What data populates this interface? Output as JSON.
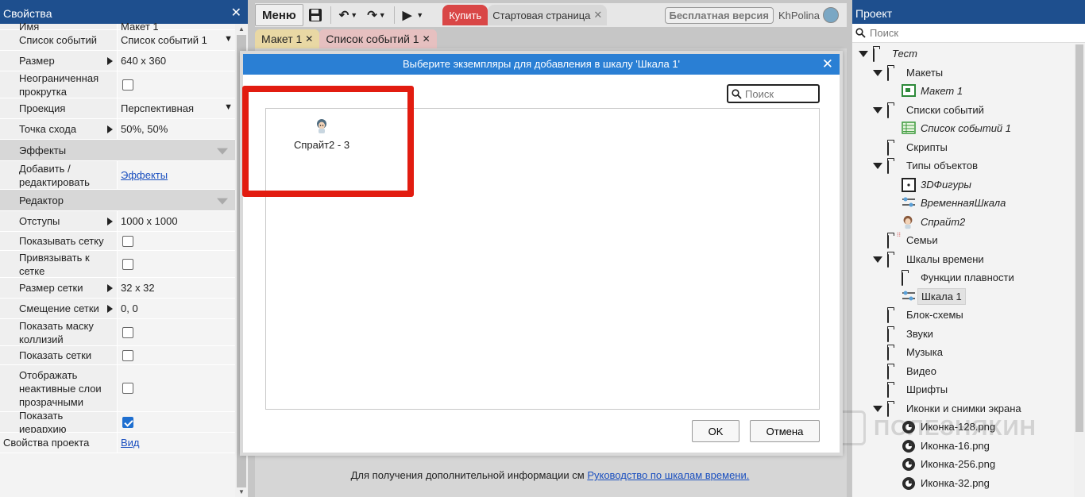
{
  "left_panel": {
    "title": "Свойства",
    "rows": [
      {
        "type": "value",
        "key": "Имя",
        "value": "Макет 1"
      },
      {
        "type": "select",
        "key": "Список событий",
        "value": "Список событий 1"
      },
      {
        "type": "expand",
        "key": "Размер",
        "value": "640 x 360"
      },
      {
        "type": "checkbox",
        "key": "Неограниченная прокрутка",
        "checked": false
      },
      {
        "type": "select",
        "key": "Проекция",
        "value": "Перспективная"
      },
      {
        "type": "expand",
        "key": "Точка схода",
        "value": "50%,  50%"
      },
      {
        "type": "section",
        "key": "Эффекты"
      },
      {
        "type": "link",
        "key": "Добавить / редактировать",
        "value": "Эффекты"
      },
      {
        "type": "section",
        "key": "Редактор"
      },
      {
        "type": "expand",
        "key": "Отступы",
        "value": "1000 x 1000"
      },
      {
        "type": "checkbox",
        "key": "Показывать сетку",
        "checked": false
      },
      {
        "type": "checkbox",
        "key": "Привязывать к сетке",
        "checked": false
      },
      {
        "type": "expand",
        "key": "Размер сетки",
        "value": "32 x 32"
      },
      {
        "type": "expand",
        "key": "Смещение сетки",
        "value": "0,  0"
      },
      {
        "type": "checkbox",
        "key": "Показать маску коллизий",
        "checked": false
      },
      {
        "type": "checkbox",
        "key": "Показать сетки",
        "checked": false
      },
      {
        "type": "checkbox",
        "key": "Отображать неактивные слои прозрачными",
        "checked": false
      },
      {
        "type": "checkbox",
        "key": "Показать иерархию",
        "checked": true
      },
      {
        "type": "proj",
        "key": "Свойства проекта",
        "value": "Вид"
      }
    ]
  },
  "toolbar": {
    "menu_label": "Меню",
    "buy_tab": "Купить",
    "start_tab": "Стартовая страница",
    "free_badge": "Бесплатная версия",
    "user_name": "KhPolina"
  },
  "doc_tabs": [
    {
      "label": "Макет 1"
    },
    {
      "label": "Список событий 1"
    }
  ],
  "info_line": {
    "text": "Для получения дополнительной информации см ",
    "link": "Руководство по шкалам времени."
  },
  "dialog": {
    "title": "Выберите экземпляры для добавления в шкалу 'Шкала 1'",
    "search_placeholder": "Поиск",
    "items": [
      {
        "label": "Спрайт2 - 3",
        "icon": "sprite-icon"
      }
    ],
    "ok_label": "OK",
    "cancel_label": "Отмена"
  },
  "right_panel": {
    "title": "Проект",
    "search_placeholder": "Поиск",
    "tree": [
      {
        "label": "Тест",
        "icon": "folder",
        "level": 0,
        "expand": true,
        "italic": true
      },
      {
        "label": "Макеты",
        "icon": "folder",
        "level": 1,
        "expand": true
      },
      {
        "label": "Макет 1",
        "icon": "layout",
        "level": 2,
        "italic": true
      },
      {
        "label": "Списки событий",
        "icon": "folder",
        "level": 1,
        "expand": true
      },
      {
        "label": "Список событий 1",
        "icon": "eventsheet",
        "level": 2,
        "italic": true
      },
      {
        "label": "Скрипты",
        "icon": "folder",
        "level": 1
      },
      {
        "label": "Типы объектов",
        "icon": "folder",
        "level": 1,
        "expand": true
      },
      {
        "label": "3DФигуры",
        "icon": "shape3d",
        "level": 2,
        "italic": true
      },
      {
        "label": "ВременнаяШкала",
        "icon": "timeline",
        "level": 2,
        "italic": true
      },
      {
        "label": "Спрайт2",
        "icon": "sprite",
        "level": 2,
        "italic": true
      },
      {
        "label": "Семьи",
        "icon": "folder-family",
        "level": 1
      },
      {
        "label": "Шкалы времени",
        "icon": "folder",
        "level": 1,
        "expand": true
      },
      {
        "label": "Функции плавности",
        "icon": "folder",
        "level": 2
      },
      {
        "label": "Шкала 1",
        "icon": "timeline",
        "level": 2,
        "selected": true
      },
      {
        "label": "Блок-схемы",
        "icon": "folder",
        "level": 1
      },
      {
        "label": "Звуки",
        "icon": "folder",
        "level": 1
      },
      {
        "label": "Музыка",
        "icon": "folder",
        "level": 1
      },
      {
        "label": "Видео",
        "icon": "folder",
        "level": 1
      },
      {
        "label": "Шрифты",
        "icon": "folder",
        "level": 1
      },
      {
        "label": "Иконки и снимки экрана",
        "icon": "folder",
        "level": 1,
        "expand": true
      },
      {
        "label": "Иконка-128.png",
        "icon": "image",
        "level": 2
      },
      {
        "label": "Иконка-16.png",
        "icon": "image",
        "level": 2
      },
      {
        "label": "Иконка-256.png",
        "icon": "image",
        "level": 2
      },
      {
        "label": "Иконка-32.png",
        "icon": "image",
        "level": 2
      }
    ]
  },
  "watermark": {
    "text": "ПОЛЕЗНЯКИН"
  },
  "colors": {
    "panel_header": "#1e4f8e",
    "dialog_header": "#2a7fd4",
    "highlight": "#e21c10",
    "buy_tab": "#d94646",
    "link": "#1a4fbf"
  }
}
